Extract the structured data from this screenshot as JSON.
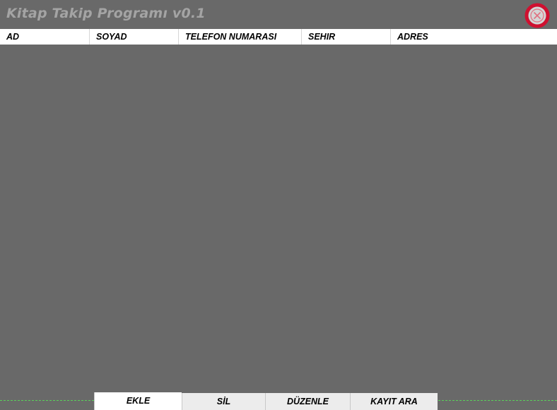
{
  "window": {
    "title": "Kitap Takip Programı v0.1"
  },
  "grid": {
    "columns": [
      "AD",
      "SOYAD",
      "TELEFON NUMARASI",
      "SEHIR",
      "ADRES"
    ],
    "rows": []
  },
  "tabs": [
    {
      "label": "EKLE",
      "active": true
    },
    {
      "label": "SİL",
      "active": false
    },
    {
      "label": "DÜZENLE",
      "active": false
    },
    {
      "label": "KAYIT ARA",
      "active": false
    }
  ],
  "icons": {
    "close": "close-icon"
  },
  "colors": {
    "background": "#696969",
    "title_text": "#a4a4a4",
    "close_icon": "#d01030",
    "header_bg": "#ffffff",
    "divider_line": "#5ad05a"
  }
}
